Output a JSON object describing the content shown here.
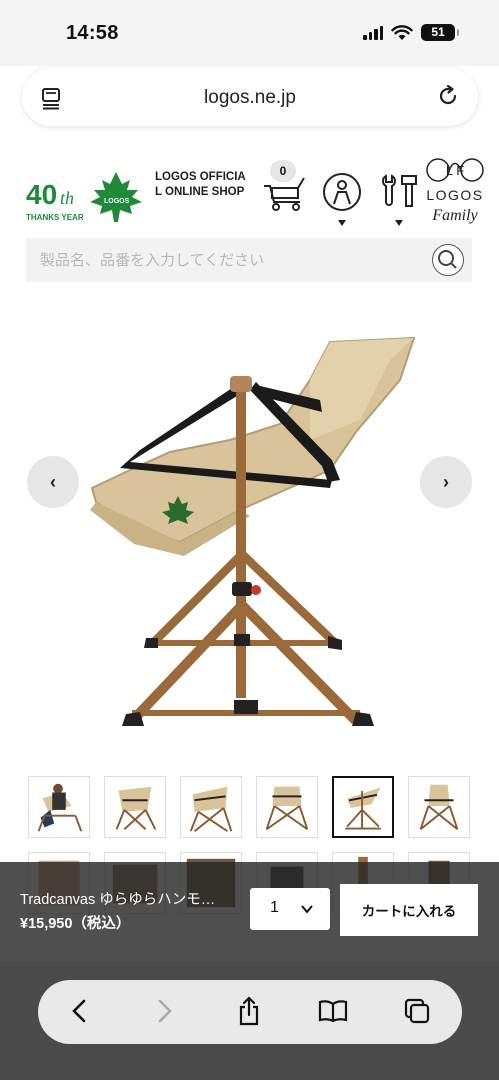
{
  "status": {
    "time": "14:58",
    "battery": "51"
  },
  "browser": {
    "url": "logos.ne.jp"
  },
  "header": {
    "anniversary_main": "40",
    "anniversary_suffix": "th",
    "anniversary_sub": "THANKS YEAR",
    "brand_leaf_text": "LOGOS",
    "shop_name": "LOGOS OFFICIA L ONLINE SHOP",
    "cart_count": "0",
    "family_top": "L  F",
    "family_logo": "LOGOS",
    "family_script": "Family"
  },
  "search": {
    "placeholder": "製品名、品番を入力してください"
  },
  "carousel": {
    "prev": "‹",
    "next": "›"
  },
  "thumbnails": [
    {
      "name": "thumb-1"
    },
    {
      "name": "thumb-2"
    },
    {
      "name": "thumb-3"
    },
    {
      "name": "thumb-4"
    },
    {
      "name": "thumb-5",
      "selected": true
    },
    {
      "name": "thumb-6"
    }
  ],
  "purchase": {
    "product_name": "Tradcanvas ゆらゆらハンモ…",
    "price": "¥15,950（税込）",
    "quantity": "1",
    "add_to_cart": "カートに入れる"
  },
  "colors": {
    "brand_green": "#1e8a3a",
    "frame_brown": "#9a6a3a",
    "canvas_beige": "#d8c39a"
  }
}
